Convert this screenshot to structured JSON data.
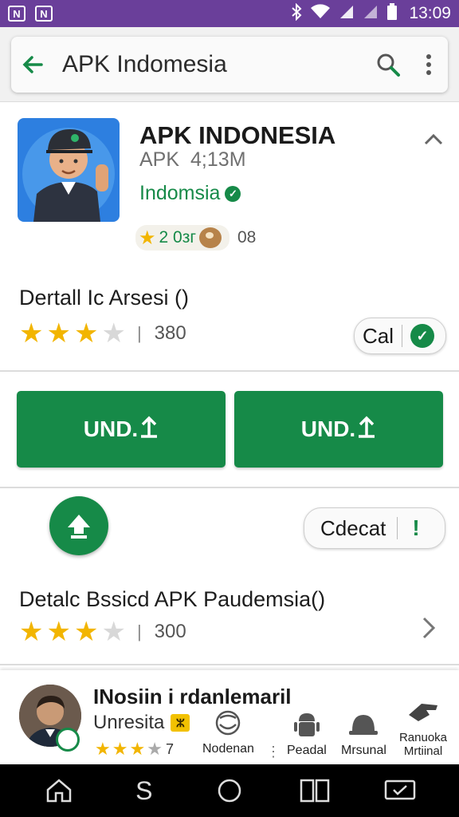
{
  "status_bar": {
    "left_icons": [
      "N",
      "N"
    ],
    "time": "13:09"
  },
  "search": {
    "title": "APK Indomesia"
  },
  "app": {
    "name": "APK INDONESIA",
    "type": "APK",
    "size": "4;13M",
    "developer": "Indomsia",
    "badge_text": "2 0зг",
    "badge_count": "08"
  },
  "section1": {
    "title": "Dertall Ic Arsesi ()",
    "rating_filled": 3,
    "rating_total": 4,
    "rating_count": "380",
    "pill_label": "Cal"
  },
  "install_buttons": [
    {
      "label": "UND."
    },
    {
      "label": "UND."
    }
  ],
  "section3": {
    "pill_label": "Cdecat",
    "title": "Detalc Bssicd APK Paudemsia()",
    "rating_filled": 3,
    "rating_total": 4,
    "rating_count": "300"
  },
  "bottom_panel": {
    "name": "INosiin i rdanlemaril",
    "sub": "Unresita",
    "rating_count": "7",
    "categories": [
      {
        "label": "Nodenan",
        "icon": "face-mask-icon"
      },
      {
        "label": "Peadal",
        "icon": "android-icon"
      },
      {
        "label": "Mrsunal",
        "icon": "bell-icon"
      },
      {
        "label": "Ranuoka Mrtiinal",
        "icon": "hand-icon"
      }
    ]
  },
  "nav": {
    "items": [
      "home-icon",
      "s-icon",
      "circle-icon",
      "recent-apps-icon",
      "keyboard-icon"
    ],
    "s_label": "S"
  },
  "colors": {
    "status_bar": "#6a3f9a",
    "accent_green": "#168a48",
    "star_yellow": "#f2b500"
  }
}
